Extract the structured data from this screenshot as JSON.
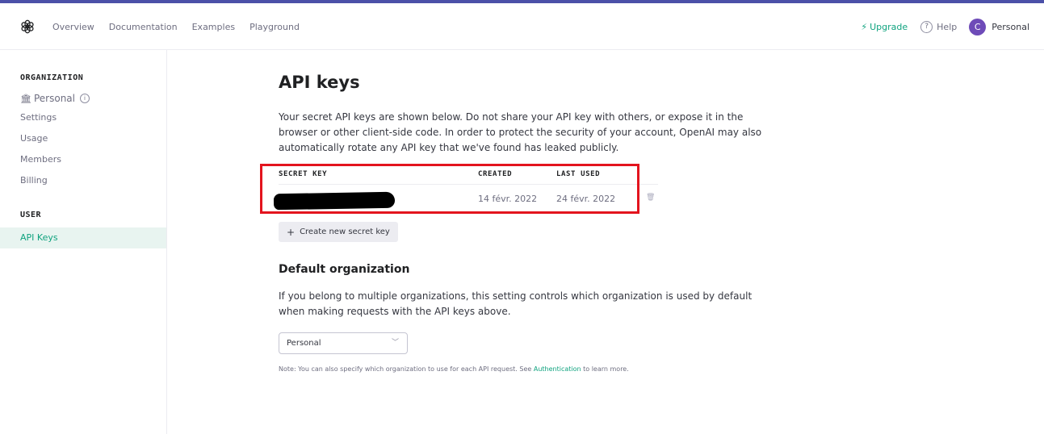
{
  "header": {
    "nav": [
      "Overview",
      "Documentation",
      "Examples",
      "Playground"
    ],
    "upgrade_label": "Upgrade",
    "help_label": "Help",
    "avatar_initial": "C",
    "account_label": "Personal"
  },
  "sidebar": {
    "org_heading": "ORGANIZATION",
    "org_name": "Personal",
    "org_items": [
      "Settings",
      "Usage",
      "Members",
      "Billing"
    ],
    "user_heading": "USER",
    "active_item": "API Keys"
  },
  "main": {
    "title": "API keys",
    "intro": "Your secret API keys are shown below. Do not share your API key with others, or expose it in the browser or other client-side code. In order to protect the security of your account, OpenAI may also automatically rotate any API key that we've found has leaked publicly.",
    "table": {
      "columns": [
        "SECRET KEY",
        "CREATED",
        "LAST USED"
      ],
      "rows": [
        {
          "created": "14 févr. 2022",
          "last_used": "24 févr. 2022"
        }
      ]
    },
    "create_button": "Create new secret key",
    "default_org_title": "Default organization",
    "default_org_desc": "If you belong to multiple organizations, this setting controls which organization is used by default when making requests with the API keys above.",
    "select_value": "Personal",
    "note_prefix": "Note: You can also specify which organization to use for each API request. See ",
    "note_link": "Authentication",
    "note_suffix": " to learn more."
  },
  "colors": {
    "accent": "#10a37f",
    "highlight": "#e3141e",
    "top_bar": "#4b50a8"
  }
}
